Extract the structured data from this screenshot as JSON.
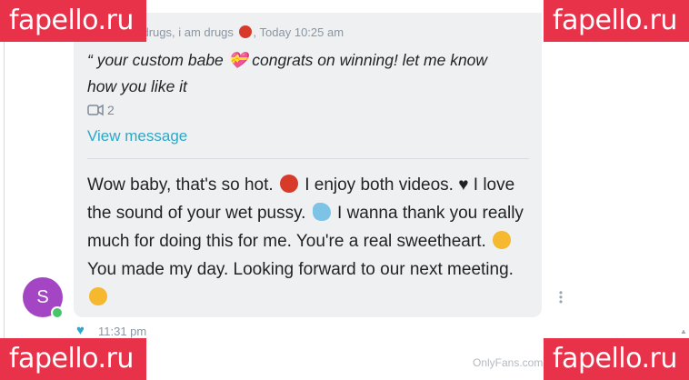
{
  "watermark": {
    "text": "fapello.ru"
  },
  "quoted_message": {
    "header_left": "| i dont do drugs, i am drugs",
    "header_time": "Today 10:25 am",
    "text": "“ your custom babe 💝 congrats on winning! let me know how you like it",
    "media_icon": "video-icon",
    "media_count": "2",
    "view_link": "View message"
  },
  "message": {
    "segments": [
      "Wow baby, that's so hot.",
      "I enjoy both videos. ♥ I love the sound of your wet pussy.",
      "I wanna thank you really much for doing this for me. You're a real sweetheart.",
      "You made my day. Looking forward to our next meeting."
    ]
  },
  "sender": {
    "avatar_letter": "S",
    "online": true
  },
  "meta": {
    "time": "11:31 pm",
    "like_icon": "heart-icon"
  },
  "footer": {
    "site": "OnlyFans.com"
  },
  "colors": {
    "accent": "#2da8c7",
    "badge": "#e8324a",
    "avatar": "#a446c4",
    "bubble": "#eef0f2"
  }
}
